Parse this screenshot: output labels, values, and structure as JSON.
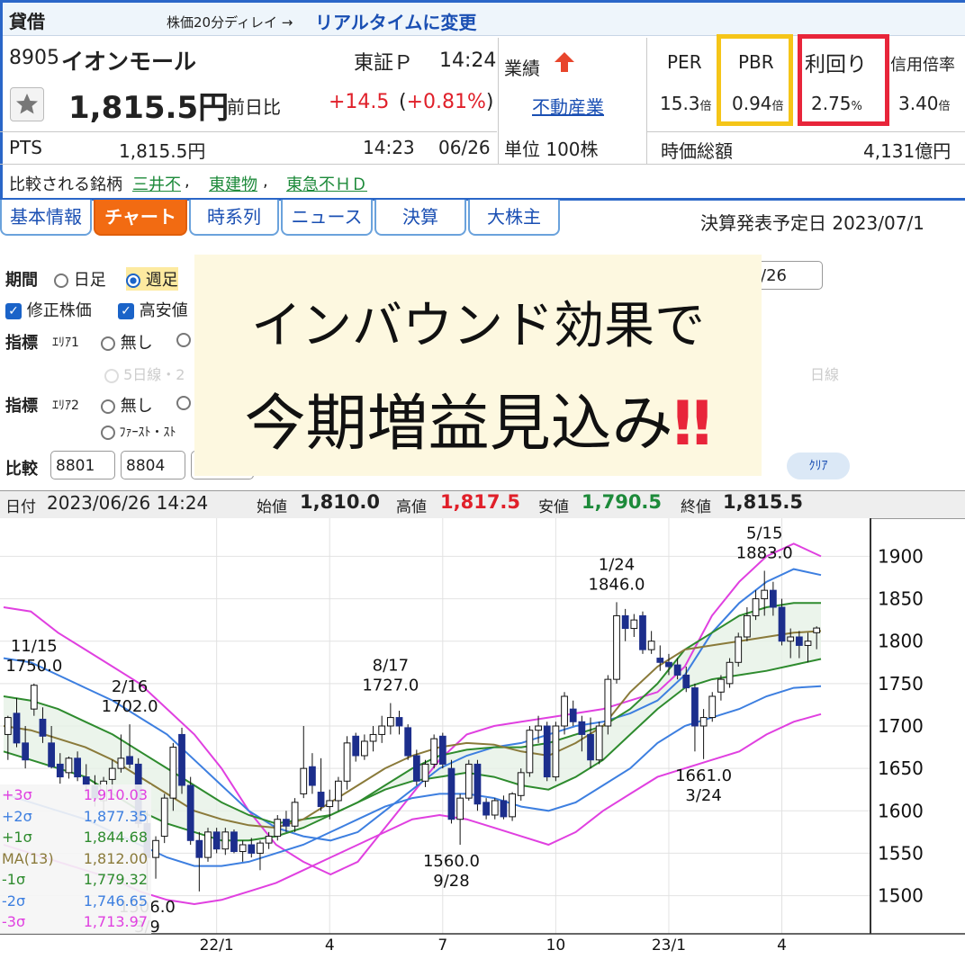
{
  "header": {
    "kashi": "貸借",
    "delay_note": "株価20分ディレイ →",
    "realtime_link": "リアルタイムに変更"
  },
  "stock": {
    "code": "8905",
    "name": "イオンモール",
    "market": "東証Ｐ",
    "time": "14:24",
    "price": "1,815.5円",
    "change_label": "前日比",
    "change": "+14.5",
    "change_pct": "(+0.81%)",
    "pts_label": "PTS",
    "pts_price": "1,815.5円",
    "pts_time": "14:23",
    "pts_date": "06/26",
    "compare_label": "比較される銘柄",
    "compare_1": "三井不",
    "compare_2": "東建物",
    "compare_3": "東急不ＨＤ",
    "sep": ","
  },
  "performance": {
    "label": "業績",
    "industry": "不動産業",
    "unit": "単位 100株"
  },
  "metrics": {
    "per_label": "PER",
    "per_value": "15.3",
    "per_unit": "倍",
    "pbr_label": "PBR",
    "pbr_value": "0.94",
    "pbr_unit": "倍",
    "yield_label": "利回り",
    "yield_value": "2.75",
    "yield_unit": "%",
    "margin_label": "信用倍率",
    "margin_value": "3.40",
    "margin_unit": "倍",
    "mcap_label": "時価総額",
    "mcap_value": "4,131億円",
    "pbr_box_color": "#f5c518",
    "yield_box_color": "#e8253a"
  },
  "tabs": [
    "基本情報",
    "チャート",
    "時系列",
    "ニュース",
    "決算",
    "大株主"
  ],
  "earnings_date": "決算発表予定日  2023/07/1",
  "controls": {
    "period_label": "期間",
    "daily": "日足",
    "weekly": "週足",
    "date_field": "/26",
    "adjusted": "修正株価",
    "highlow": "高安値",
    "indicator_label": "指標",
    "area1": "ｴﾘｱ1",
    "area2": "ｴﾘｱ2",
    "none": "無し",
    "ma5": "5日線・2",
    "ma_day": "日線",
    "fast_stoch": "ﾌｧｰｽﾄ・ｽﾄ",
    "compare_label": "比較",
    "compare_1": "8801",
    "compare_2": "8804",
    "clear": "ｸﾘｱ"
  },
  "overlay": {
    "line1": "インバウンド効果で",
    "line2": "今期増益見込み",
    "mark": "‼"
  },
  "chart_header": {
    "date_label": "日付",
    "date_value": "2023/06/26 14:24",
    "open_label": "始値",
    "open": "1,810.0",
    "high_label": "高値",
    "high": "1,817.5",
    "low_label": "安値",
    "low": "1,790.5",
    "close_label": "終値",
    "close": "1,815.5"
  },
  "chart_data": {
    "type": "candlestick",
    "ylim": [
      1455,
      1945
    ],
    "yticks": [
      "1900",
      "1850",
      "1800",
      "1750",
      "1700",
      "1650",
      "1600",
      "1550",
      "1500"
    ],
    "xticks": [
      "22/1",
      "4",
      "7",
      "10",
      "23/1",
      "4"
    ],
    "annotations": [
      {
        "date": "11/15",
        "value": "1750.0"
      },
      {
        "date": "2/16",
        "value": "1702.0"
      },
      {
        "date": "3/9",
        "value": "1506.0"
      },
      {
        "date": "8/17",
        "value": "1727.0"
      },
      {
        "date": "9/28",
        "value": "1560.0"
      },
      {
        "date": "1/24",
        "value": "1846.0"
      },
      {
        "date": "3/24",
        "value": "1661.0"
      },
      {
        "date": "5/15",
        "value": "1883.0"
      }
    ],
    "legend": [
      {
        "label": "+3σ",
        "value": "1,910.03",
        "color": "#e040e0"
      },
      {
        "label": "+2σ",
        "value": "1,877.35",
        "color": "#3d7fe0"
      },
      {
        "label": "+1σ",
        "value": "1,844.68",
        "color": "#2e8b2e"
      },
      {
        "label": "MA(13)",
        "value": "1,812.00",
        "color": "#8a7a3a"
      },
      {
        "label": "-1σ",
        "value": "1,779.32",
        "color": "#2e8b2e"
      },
      {
        "label": "-2σ",
        "value": "1,746.65",
        "color": "#3d7fe0"
      },
      {
        "label": "-3σ",
        "value": "1,713.97",
        "color": "#e040e0"
      }
    ],
    "candles": [
      {
        "o": 1690,
        "h": 1712,
        "l": 1660,
        "c": 1710
      },
      {
        "o": 1715,
        "h": 1733,
        "l": 1675,
        "c": 1680
      },
      {
        "o": 1680,
        "h": 1700,
        "l": 1650,
        "c": 1660
      },
      {
        "o": 1720,
        "h": 1750,
        "l": 1712,
        "c": 1748
      },
      {
        "o": 1708,
        "h": 1722,
        "l": 1680,
        "c": 1688
      },
      {
        "o": 1680,
        "h": 1700,
        "l": 1650,
        "c": 1652
      },
      {
        "o": 1655,
        "h": 1668,
        "l": 1632,
        "c": 1640
      },
      {
        "o": 1645,
        "h": 1664,
        "l": 1638,
        "c": 1662
      },
      {
        "o": 1662,
        "h": 1670,
        "l": 1635,
        "c": 1640
      },
      {
        "o": 1640,
        "h": 1655,
        "l": 1620,
        "c": 1630
      },
      {
        "o": 1630,
        "h": 1642,
        "l": 1605,
        "c": 1615
      },
      {
        "o": 1612,
        "h": 1640,
        "l": 1600,
        "c": 1635
      },
      {
        "o": 1637,
        "h": 1660,
        "l": 1625,
        "c": 1650
      },
      {
        "o": 1650,
        "h": 1690,
        "l": 1645,
        "c": 1662
      },
      {
        "o": 1664,
        "h": 1702,
        "l": 1650,
        "c": 1655
      },
      {
        "o": 1655,
        "h": 1662,
        "l": 1580,
        "c": 1585
      },
      {
        "o": 1585,
        "h": 1600,
        "l": 1506,
        "c": 1545
      },
      {
        "o": 1545,
        "h": 1570,
        "l": 1520,
        "c": 1565
      },
      {
        "o": 1570,
        "h": 1620,
        "l": 1562,
        "c": 1615
      },
      {
        "o": 1615,
        "h": 1680,
        "l": 1600,
        "c": 1675
      },
      {
        "o": 1690,
        "h": 1698,
        "l": 1620,
        "c": 1630
      },
      {
        "o": 1630,
        "h": 1640,
        "l": 1560,
        "c": 1565
      },
      {
        "o": 1565,
        "h": 1575,
        "l": 1505,
        "c": 1545
      },
      {
        "o": 1545,
        "h": 1580,
        "l": 1540,
        "c": 1575
      },
      {
        "o": 1575,
        "h": 1580,
        "l": 1550,
        "c": 1555
      },
      {
        "o": 1555,
        "h": 1580,
        "l": 1548,
        "c": 1575
      },
      {
        "o": 1575,
        "h": 1578,
        "l": 1550,
        "c": 1552
      },
      {
        "o": 1552,
        "h": 1565,
        "l": 1540,
        "c": 1560
      },
      {
        "o": 1560,
        "h": 1568,
        "l": 1545,
        "c": 1550
      },
      {
        "o": 1550,
        "h": 1565,
        "l": 1530,
        "c": 1562
      },
      {
        "o": 1562,
        "h": 1575,
        "l": 1555,
        "c": 1570
      },
      {
        "o": 1570,
        "h": 1595,
        "l": 1565,
        "c": 1590
      },
      {
        "o": 1590,
        "h": 1600,
        "l": 1575,
        "c": 1582
      },
      {
        "o": 1582,
        "h": 1615,
        "l": 1575,
        "c": 1610
      },
      {
        "o": 1620,
        "h": 1700,
        "l": 1615,
        "c": 1650
      },
      {
        "o": 1652,
        "h": 1668,
        "l": 1620,
        "c": 1630
      },
      {
        "o": 1622,
        "h": 1662,
        "l": 1600,
        "c": 1605
      },
      {
        "o": 1605,
        "h": 1625,
        "l": 1590,
        "c": 1612
      },
      {
        "o": 1612,
        "h": 1640,
        "l": 1600,
        "c": 1635
      },
      {
        "o": 1635,
        "h": 1688,
        "l": 1625,
        "c": 1680
      },
      {
        "o": 1688,
        "h": 1692,
        "l": 1658,
        "c": 1665
      },
      {
        "o": 1665,
        "h": 1690,
        "l": 1660,
        "c": 1682
      },
      {
        "o": 1682,
        "h": 1700,
        "l": 1670,
        "c": 1690
      },
      {
        "o": 1690,
        "h": 1712,
        "l": 1680,
        "c": 1700
      },
      {
        "o": 1700,
        "h": 1727,
        "l": 1690,
        "c": 1710
      },
      {
        "o": 1710,
        "h": 1718,
        "l": 1690,
        "c": 1700
      },
      {
        "o": 1698,
        "h": 1702,
        "l": 1660,
        "c": 1665
      },
      {
        "o": 1665,
        "h": 1672,
        "l": 1630,
        "c": 1635
      },
      {
        "o": 1635,
        "h": 1660,
        "l": 1628,
        "c": 1655
      },
      {
        "o": 1655,
        "h": 1690,
        "l": 1650,
        "c": 1685
      },
      {
        "o": 1688,
        "h": 1692,
        "l": 1650,
        "c": 1655
      },
      {
        "o": 1650,
        "h": 1660,
        "l": 1585,
        "c": 1590
      },
      {
        "o": 1590,
        "h": 1620,
        "l": 1560,
        "c": 1615
      },
      {
        "o": 1615,
        "h": 1660,
        "l": 1612,
        "c": 1655
      },
      {
        "o": 1655,
        "h": 1660,
        "l": 1600,
        "c": 1608
      },
      {
        "o": 1610,
        "h": 1615,
        "l": 1590,
        "c": 1595
      },
      {
        "o": 1595,
        "h": 1615,
        "l": 1590,
        "c": 1612
      },
      {
        "o": 1612,
        "h": 1618,
        "l": 1590,
        "c": 1593
      },
      {
        "o": 1593,
        "h": 1622,
        "l": 1588,
        "c": 1620
      },
      {
        "o": 1618,
        "h": 1650,
        "l": 1612,
        "c": 1645
      },
      {
        "o": 1645,
        "h": 1700,
        "l": 1640,
        "c": 1695
      },
      {
        "o": 1695,
        "h": 1712,
        "l": 1680,
        "c": 1700
      },
      {
        "o": 1700,
        "h": 1705,
        "l": 1635,
        "c": 1640
      },
      {
        "o": 1640,
        "h": 1705,
        "l": 1635,
        "c": 1700
      },
      {
        "o": 1700,
        "h": 1740,
        "l": 1690,
        "c": 1735
      },
      {
        "o": 1720,
        "h": 1730,
        "l": 1700,
        "c": 1705
      },
      {
        "o": 1705,
        "h": 1712,
        "l": 1670,
        "c": 1690
      },
      {
        "o": 1690,
        "h": 1710,
        "l": 1650,
        "c": 1660
      },
      {
        "o": 1660,
        "h": 1705,
        "l": 1655,
        "c": 1700
      },
      {
        "o": 1700,
        "h": 1760,
        "l": 1690,
        "c": 1755
      },
      {
        "o": 1755,
        "h": 1846,
        "l": 1750,
        "c": 1830
      },
      {
        "o": 1830,
        "h": 1838,
        "l": 1800,
        "c": 1815
      },
      {
        "o": 1815,
        "h": 1832,
        "l": 1805,
        "c": 1825
      },
      {
        "o": 1830,
        "h": 1835,
        "l": 1785,
        "c": 1790
      },
      {
        "o": 1790,
        "h": 1812,
        "l": 1785,
        "c": 1800
      },
      {
        "o": 1780,
        "h": 1795,
        "l": 1765,
        "c": 1775
      },
      {
        "o": 1775,
        "h": 1785,
        "l": 1760,
        "c": 1770
      },
      {
        "o": 1772,
        "h": 1780,
        "l": 1755,
        "c": 1760
      },
      {
        "o": 1760,
        "h": 1770,
        "l": 1740,
        "c": 1745
      },
      {
        "o": 1745,
        "h": 1750,
        "l": 1670,
        "c": 1700
      },
      {
        "o": 1700,
        "h": 1720,
        "l": 1661,
        "c": 1710
      },
      {
        "o": 1710,
        "h": 1740,
        "l": 1705,
        "c": 1735
      },
      {
        "o": 1740,
        "h": 1760,
        "l": 1730,
        "c": 1755
      },
      {
        "o": 1750,
        "h": 1780,
        "l": 1745,
        "c": 1775
      },
      {
        "o": 1775,
        "h": 1810,
        "l": 1770,
        "c": 1805
      },
      {
        "o": 1805,
        "h": 1840,
        "l": 1800,
        "c": 1830
      },
      {
        "o": 1830,
        "h": 1860,
        "l": 1825,
        "c": 1850
      },
      {
        "o": 1850,
        "h": 1883,
        "l": 1830,
        "c": 1860
      },
      {
        "o": 1860,
        "h": 1870,
        "l": 1830,
        "c": 1840
      },
      {
        "o": 1840,
        "h": 1850,
        "l": 1795,
        "c": 1800
      },
      {
        "o": 1800,
        "h": 1815,
        "l": 1780,
        "c": 1805
      },
      {
        "o": 1805,
        "h": 1812,
        "l": 1780,
        "c": 1795
      },
      {
        "o": 1795,
        "h": 1810,
        "l": 1775,
        "c": 1800
      },
      {
        "o": 1810,
        "h": 1817.5,
        "l": 1790.5,
        "c": 1815.5
      }
    ],
    "bands": {
      "p3": [
        1840,
        1835,
        1810,
        1790,
        1770,
        1750,
        1720,
        1690,
        1650,
        1600,
        1560,
        1540,
        1525,
        1540,
        1580,
        1620,
        1660,
        1690,
        1700,
        1705,
        1710,
        1715,
        1720,
        1730,
        1740,
        1770,
        1830,
        1870,
        1900,
        1915,
        1900
      ],
      "p2": [
        1780,
        1775,
        1760,
        1745,
        1730,
        1710,
        1690,
        1660,
        1630,
        1600,
        1580,
        1570,
        1565,
        1575,
        1600,
        1625,
        1650,
        1665,
        1675,
        1680,
        1690,
        1700,
        1705,
        1715,
        1730,
        1760,
        1810,
        1845,
        1870,
        1885,
        1878
      ],
      "p1": [
        1735,
        1730,
        1720,
        1705,
        1690,
        1670,
        1650,
        1630,
        1610,
        1595,
        1585,
        1590,
        1595,
        1610,
        1630,
        1650,
        1665,
        1672,
        1675,
        1675,
        1680,
        1690,
        1700,
        1720,
        1750,
        1790,
        1810,
        1830,
        1840,
        1845,
        1845
      ],
      "ma": [
        1700,
        1695,
        1685,
        1675,
        1660,
        1640,
        1620,
        1600,
        1590,
        1583,
        1580,
        1590,
        1610,
        1630,
        1650,
        1665,
        1675,
        1680,
        1678,
        1670,
        1665,
        1680,
        1700,
        1740,
        1770,
        1790,
        1795,
        1800,
        1805,
        1810,
        1812
      ],
      "m1": [
        1670,
        1660,
        1650,
        1640,
        1620,
        1600,
        1585,
        1575,
        1565,
        1565,
        1570,
        1580,
        1595,
        1610,
        1625,
        1635,
        1640,
        1645,
        1640,
        1630,
        1625,
        1640,
        1660,
        1690,
        1720,
        1745,
        1755,
        1760,
        1765,
        1772,
        1779
      ],
      "m2": [
        1620,
        1610,
        1600,
        1590,
        1575,
        1560,
        1545,
        1535,
        1535,
        1540,
        1550,
        1560,
        1575,
        1590,
        1605,
        1615,
        1620,
        1620,
        1615,
        1605,
        1600,
        1610,
        1630,
        1650,
        1680,
        1700,
        1710,
        1720,
        1735,
        1745,
        1747
      ],
      "m3": [
        1560,
        1550,
        1540,
        1530,
        1520,
        1505,
        1495,
        1490,
        1495,
        1505,
        1515,
        1530,
        1545,
        1560,
        1575,
        1590,
        1595,
        1590,
        1580,
        1570,
        1560,
        1575,
        1600,
        1620,
        1640,
        1650,
        1660,
        1670,
        1690,
        1705,
        1714
      ]
    }
  }
}
